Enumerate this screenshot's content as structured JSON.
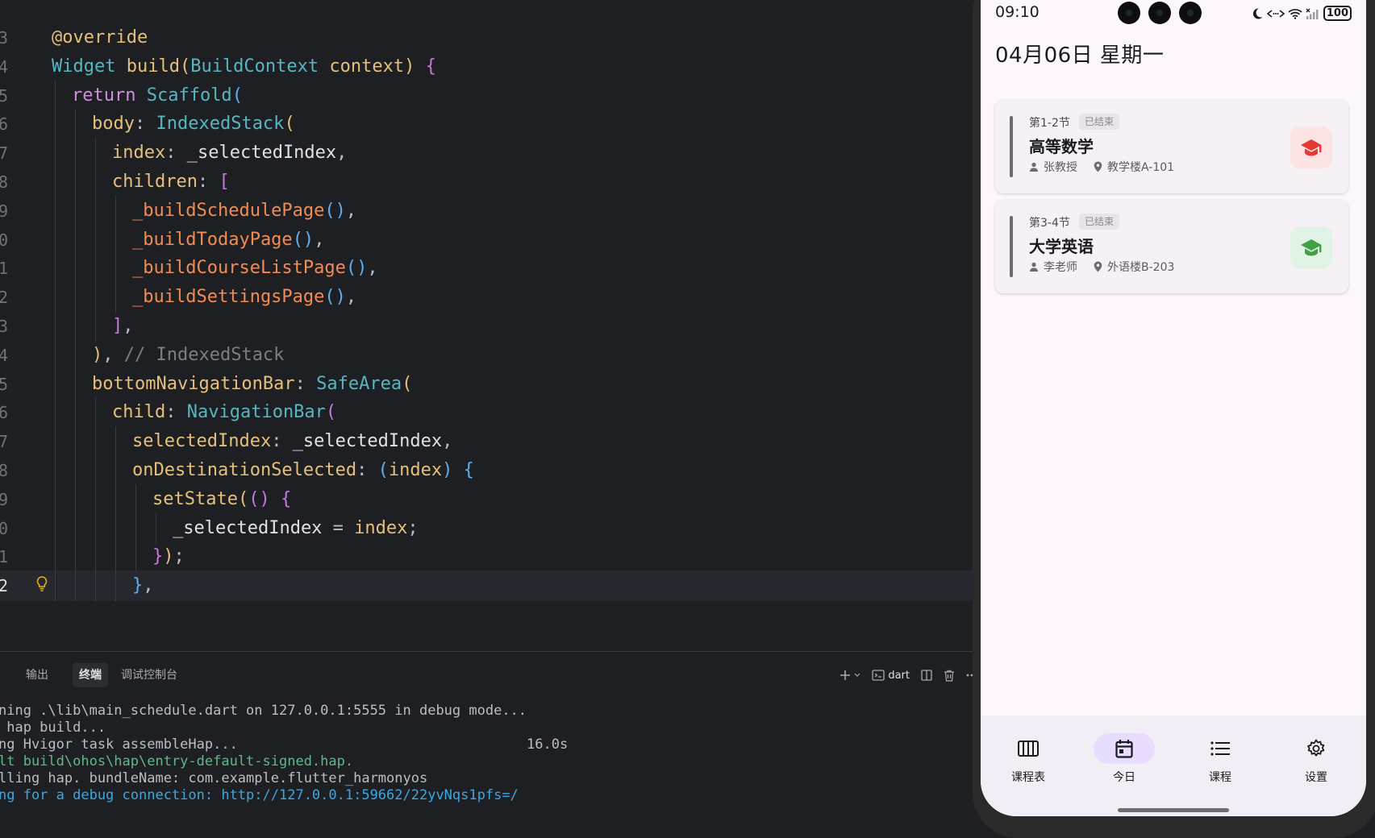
{
  "editor": {
    "lines": [
      {
        "num": "3",
        "tokens": [
          [
            "@override",
            "ann"
          ]
        ]
      },
      {
        "num": "4",
        "tokens": [
          [
            "Widget ",
            "fn"
          ],
          [
            "build",
            "prop"
          ],
          [
            "(",
            "p1"
          ],
          [
            "BuildContext ",
            "fn"
          ],
          [
            "context",
            "prop"
          ],
          [
            ")",
            "p1"
          ],
          [
            " {",
            "p2"
          ]
        ]
      },
      {
        "num": "5",
        "tokens": [
          [
            "return ",
            "kw"
          ],
          [
            "Scaffold",
            "fn"
          ],
          [
            "(",
            "p3"
          ]
        ]
      },
      {
        "num": "6",
        "tokens": [
          [
            "body",
            "prop"
          ],
          [
            ": ",
            "pn"
          ],
          [
            "IndexedStack",
            "fn"
          ],
          [
            "(",
            "p1"
          ]
        ]
      },
      {
        "num": "7",
        "tokens": [
          [
            "index",
            "prop"
          ],
          [
            ": ",
            "pn"
          ],
          [
            "_selectedIndex",
            "id"
          ],
          [
            ",",
            "pn"
          ]
        ]
      },
      {
        "num": "8",
        "tokens": [
          [
            "children",
            "prop"
          ],
          [
            ": ",
            "pn"
          ],
          [
            "[",
            "p2"
          ]
        ]
      },
      {
        "num": "9",
        "tokens": [
          [
            "_buildSchedulePage",
            "call"
          ],
          [
            "()",
            "p3"
          ],
          [
            ",",
            "pn"
          ]
        ]
      },
      {
        "num": "0",
        "tokens": [
          [
            "_buildTodayPage",
            "call"
          ],
          [
            "()",
            "p3"
          ],
          [
            ",",
            "pn"
          ]
        ]
      },
      {
        "num": "1",
        "tokens": [
          [
            "_buildCourseListPage",
            "call"
          ],
          [
            "()",
            "p3"
          ],
          [
            ",",
            "pn"
          ]
        ]
      },
      {
        "num": "2",
        "tokens": [
          [
            "_buildSettingsPage",
            "call"
          ],
          [
            "()",
            "p3"
          ],
          [
            ",",
            "pn"
          ]
        ]
      },
      {
        "num": "3",
        "tokens": [
          [
            "]",
            "p2"
          ],
          [
            ",",
            "pn"
          ]
        ]
      },
      {
        "num": "4",
        "tokens": [
          [
            ")",
            "p1"
          ],
          [
            ", ",
            "pn"
          ],
          [
            "// IndexedStack",
            "cm"
          ]
        ]
      },
      {
        "num": "5",
        "tokens": [
          [
            "bottomNavigationBar",
            "prop"
          ],
          [
            ": ",
            "pn"
          ],
          [
            "SafeArea",
            "fn"
          ],
          [
            "(",
            "p1"
          ]
        ]
      },
      {
        "num": "6",
        "tokens": [
          [
            "child",
            "prop"
          ],
          [
            ": ",
            "pn"
          ],
          [
            "NavigationBar",
            "fn"
          ],
          [
            "(",
            "p2"
          ]
        ]
      },
      {
        "num": "7",
        "tokens": [
          [
            "selectedIndex",
            "prop"
          ],
          [
            ": ",
            "pn"
          ],
          [
            "_selectedIndex",
            "id"
          ],
          [
            ",",
            "pn"
          ]
        ]
      },
      {
        "num": "8",
        "tokens": [
          [
            "onDestinationSelected",
            "prop"
          ],
          [
            ": ",
            "pn"
          ],
          [
            "(",
            "p3"
          ],
          [
            "index",
            "prop"
          ],
          [
            ") ",
            "p3"
          ],
          [
            "{",
            "p3"
          ]
        ]
      },
      {
        "num": "9",
        "tokens": [
          [
            "setState",
            "prop"
          ],
          [
            "(",
            "p1"
          ],
          [
            "() ",
            "p2"
          ],
          [
            "{",
            "p2"
          ]
        ]
      },
      {
        "num": "0",
        "tokens": [
          [
            "_selectedIndex",
            "id"
          ],
          [
            " = ",
            "pn"
          ],
          [
            "index",
            "prop"
          ],
          [
            ";",
            "pn"
          ]
        ]
      },
      {
        "num": "1",
        "tokens": [
          [
            "}",
            "p2"
          ],
          [
            ")",
            "p1"
          ],
          [
            ";",
            "pn"
          ]
        ]
      },
      {
        "num": "2",
        "tokens": [
          [
            "}",
            "p3"
          ],
          [
            ",",
            "pn"
          ]
        ]
      }
    ]
  },
  "panel": {
    "tabs": [
      "输出",
      "终端",
      "调试控制台"
    ],
    "active_tab": 1,
    "terminal_name": "dart",
    "terminal_lines": [
      {
        "text": "ning .\\lib\\main_schedule.dart on 127.0.0.1:5555 in debug mode...",
        "style": ""
      },
      {
        "text": " hap build...",
        "style": ""
      },
      {
        "text": "ng Hvigor task assembleHap...                                   16.0s",
        "style": ""
      },
      {
        "text": "lt build\\ohos\\hap\\entry-default-signed.hap.",
        "style": "green"
      },
      {
        "text": "lling hap. bundleName: com.example.flutter_harmonyos",
        "style": ""
      },
      {
        "text": "ng for a debug connection: http://127.0.0.1:59662/22yvNqs1pfs=/",
        "style": "blue"
      }
    ]
  },
  "phone": {
    "status": {
      "time": "09:10",
      "battery": "100"
    },
    "date_title": "04月06日 星期一",
    "courses": [
      {
        "period": "第1-2节",
        "status": "已结束",
        "name": "高等数学",
        "teacher": "张教授",
        "location": "教学楼A-101",
        "icon_bg": "#fde4e4",
        "icon_color": "#e53935"
      },
      {
        "period": "第3-4节",
        "status": "已结束",
        "name": "大学英语",
        "teacher": "李老师",
        "location": "外语楼B-203",
        "icon_bg": "#e1f3e4",
        "icon_color": "#43a047"
      }
    ],
    "nav": [
      {
        "label": "课程表",
        "icon": "view-week-icon"
      },
      {
        "label": "今日",
        "icon": "calendar-today-icon"
      },
      {
        "label": "课程",
        "icon": "list-icon"
      },
      {
        "label": "设置",
        "icon": "settings-icon"
      }
    ],
    "nav_active": 1
  }
}
